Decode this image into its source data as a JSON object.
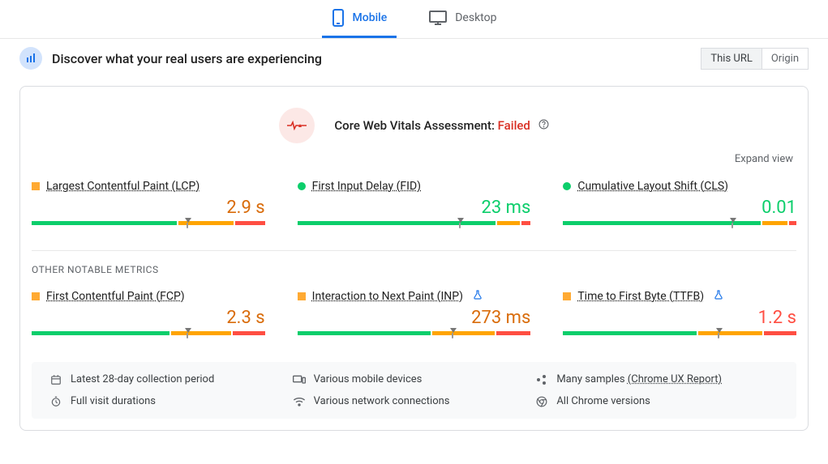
{
  "tabs": {
    "mobile": "Mobile",
    "desktop": "Desktop"
  },
  "header": {
    "title": "Discover what your real users are experiencing"
  },
  "scope_toggle": {
    "this_url": "This URL",
    "origin": "Origin"
  },
  "assessment": {
    "prefix": "Core Web Vitals Assessment: ",
    "status": "Failed"
  },
  "expand": "Expand view",
  "cwv": {
    "lcp": {
      "label": "Largest Contentful Paint (LCP)",
      "value": "2.9 s"
    },
    "fid": {
      "label": "First Input Delay (FID)",
      "value": "23 ms"
    },
    "cls": {
      "label": "Cumulative Layout Shift (CLS)",
      "value": "0.01"
    }
  },
  "other_label": "OTHER NOTABLE METRICS",
  "other": {
    "fcp": {
      "label": "First Contentful Paint (FCP)",
      "value": "2.3 s"
    },
    "inp": {
      "label": "Interaction to Next Paint (INP)",
      "value": "273 ms"
    },
    "ttfb": {
      "label": "Time to First Byte (TTFB)",
      "value": "1.2 s"
    }
  },
  "info": {
    "period": "Latest 28-day collection period",
    "devices": "Various mobile devices",
    "samples_prefix": "Many samples ",
    "samples_link": "(Chrome UX Report)",
    "durations": "Full visit durations",
    "networks": "Various network connections",
    "versions": "All Chrome versions"
  },
  "chart_data": [
    {
      "id": "lcp",
      "type": "bar",
      "status": "orange",
      "marker_pct": 67,
      "segments": [
        {
          "c": "green",
          "pct": 63
        },
        {
          "c": "orange",
          "pct": 24
        },
        {
          "c": "red",
          "pct": 13
        }
      ]
    },
    {
      "id": "fid",
      "type": "bar",
      "status": "green",
      "marker_pct": 70,
      "segments": [
        {
          "c": "green",
          "pct": 86
        },
        {
          "c": "orange",
          "pct": 10
        },
        {
          "c": "red",
          "pct": 4
        }
      ]
    },
    {
      "id": "cls",
      "type": "bar",
      "status": "green",
      "marker_pct": 73,
      "segments": [
        {
          "c": "green",
          "pct": 86
        },
        {
          "c": "orange",
          "pct": 11
        },
        {
          "c": "red",
          "pct": 3
        }
      ]
    },
    {
      "id": "fcp",
      "type": "bar",
      "status": "orange",
      "marker_pct": 67,
      "segments": [
        {
          "c": "green",
          "pct": 60
        },
        {
          "c": "orange",
          "pct": 26
        },
        {
          "c": "red",
          "pct": 14
        }
      ]
    },
    {
      "id": "inp",
      "type": "bar",
      "status": "orange",
      "marker_pct": 67,
      "segments": [
        {
          "c": "green",
          "pct": 58
        },
        {
          "c": "orange",
          "pct": 27
        },
        {
          "c": "red",
          "pct": 15
        }
      ]
    },
    {
      "id": "ttfb",
      "type": "bar",
      "status": "orange",
      "marker_pct": 67,
      "segments": [
        {
          "c": "green",
          "pct": 58
        },
        {
          "c": "orange",
          "pct": 28
        },
        {
          "c": "red",
          "pct": 14
        }
      ]
    }
  ]
}
